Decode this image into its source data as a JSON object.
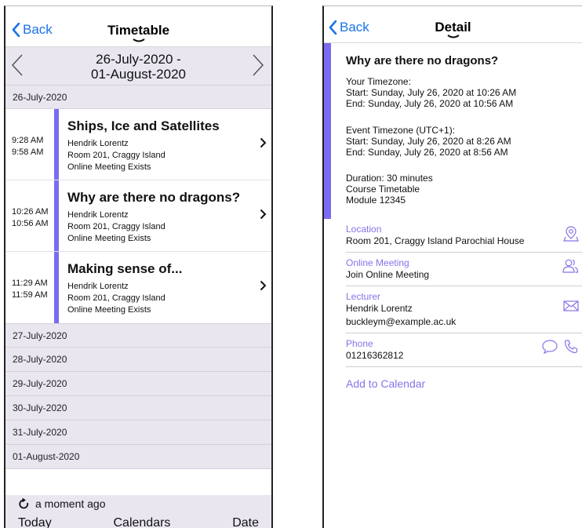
{
  "timetable": {
    "nav": {
      "back_label": "Back",
      "title": "Timetable"
    },
    "week_range": {
      "line1": "26-July-2020 -",
      "line2": "01-August-2020"
    },
    "first_day": "26-July-2020",
    "events": [
      {
        "start": "9:28 AM",
        "end": "9:58 AM",
        "title": "Ships, Ice and Satellites",
        "lecturer": "Hendrik Lorentz",
        "room": "Room 201, Craggy Island",
        "meeting": "Online Meeting Exists"
      },
      {
        "start": "10:26 AM",
        "end": "10:56 AM",
        "title": "Why are there no dragons?",
        "lecturer": "Hendrik Lorentz",
        "room": "Room 201, Craggy Island",
        "meeting": "Online Meeting Exists"
      },
      {
        "start": "11:29 AM",
        "end": "11:59 AM",
        "title": "Making sense of...",
        "lecturer": "Hendrik Lorentz",
        "room": "Room 201, Craggy Island",
        "meeting": "Online Meeting Exists"
      }
    ],
    "other_days": [
      "27-July-2020",
      "28-July-2020",
      "29-July-2020",
      "30-July-2020",
      "31-July-2020",
      "01-August-2020"
    ],
    "status": "a moment ago",
    "toolbar": {
      "today": "Today",
      "calendars": "Calendars",
      "date": "Date"
    }
  },
  "detail": {
    "nav": {
      "back_label": "Back",
      "title": "Detail"
    },
    "title": "Why are there no dragons?",
    "your_tz": {
      "heading": "Your Timezone:",
      "start": "Start: Sunday, July 26, 2020 at 10:26 AM",
      "end": "End: Sunday, July 26, 2020 at 10:56 AM"
    },
    "event_tz": {
      "heading": "Event Timezone (UTC+1):",
      "start": "Start: Sunday, July 26, 2020 at 8:26 AM",
      "end": "End: Sunday, July 26, 2020 at 8:56 AM"
    },
    "info": {
      "duration": "Duration: 30 minutes",
      "course": "Course Timetable",
      "module": "Module 12345"
    },
    "location": {
      "label": "Location",
      "value": "Room 201, Craggy Island Parochial House"
    },
    "online_meeting": {
      "label": "Online Meeting",
      "value": "Join Online Meeting"
    },
    "lecturer": {
      "label": "Lecturer",
      "name": "Hendrik Lorentz",
      "email": "buckleym@example.ac.uk"
    },
    "phone": {
      "label": "Phone",
      "value": "01216362812"
    },
    "add_to_calendar": "Add to Calendar"
  },
  "colors": {
    "accent": "#7b6bf0",
    "link": "#1a73e8",
    "label": "#8a72e8",
    "band": "#e9e6f0"
  },
  "icons": [
    "chevron-left-icon",
    "chevron-right-icon",
    "refresh-icon",
    "location-pin-icon",
    "people-icon",
    "mail-icon",
    "chat-bubble-icon",
    "phone-icon"
  ]
}
